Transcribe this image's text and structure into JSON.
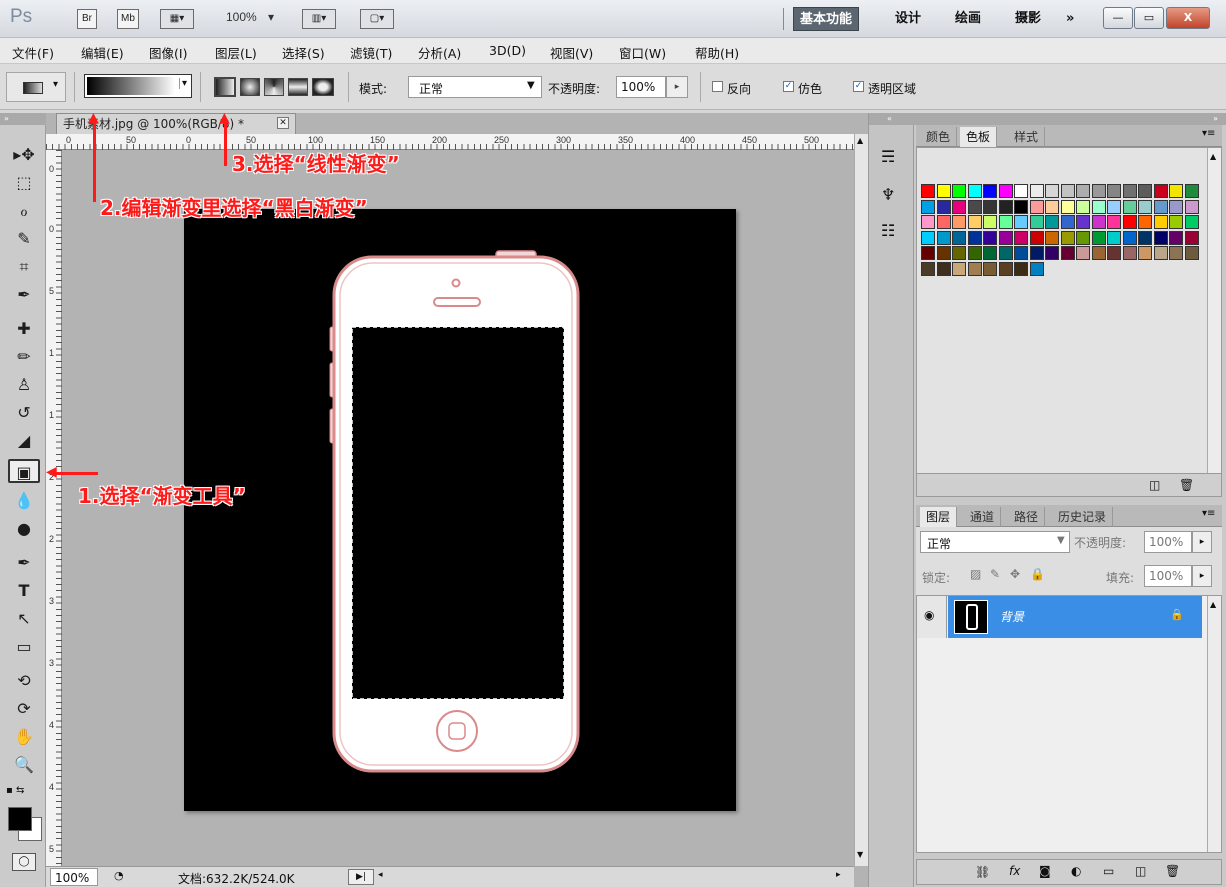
{
  "titlebar": {
    "logo": "Ps",
    "bridge": "Br",
    "minibridge": "Mb",
    "zoom": "100%",
    "workspaces": [
      "基本功能",
      "设计",
      "绘画",
      "摄影"
    ],
    "more": "»",
    "min": "—",
    "restore": "▭",
    "close": "X"
  },
  "menu": [
    "文件(F)",
    "编辑(E)",
    "图像(I)",
    "图层(L)",
    "选择(S)",
    "滤镜(T)",
    "分析(A)",
    "3D(D)",
    "视图(V)",
    "窗口(W)",
    "帮助(H)"
  ],
  "options": {
    "mode_label": "模式:",
    "mode_value": "正常",
    "opacity_label": "不透明度:",
    "opacity_value": "100%",
    "reverse": "反向",
    "dither": "仿色",
    "transparency": "透明区域"
  },
  "document": {
    "tab_title": "手机素材.jpg @ 100%(RGB/8) *",
    "ruler_h": [
      "0",
      "50",
      "0",
      "50",
      "100",
      "150",
      "200",
      "250",
      "300",
      "350",
      "400",
      "450",
      "500"
    ],
    "ruler_v": [
      "0",
      "0",
      "5",
      "1",
      "1",
      "2",
      "2",
      "3",
      "3",
      "4",
      "4",
      "5"
    ],
    "zoom": "100%",
    "doc_info": "文档:632.2K/524.0K"
  },
  "annotations": {
    "step1": "1.选择“渐变工具”",
    "step2": "2.编辑渐变里选择“黑白渐变”",
    "step3": "3.选择“线性渐变”"
  },
  "swatch_panel": {
    "tabs": [
      "颜色",
      "色板",
      "样式"
    ],
    "colors": [
      "#ff0000",
      "#ffff00",
      "#00ff00",
      "#00ffff",
      "#0000ff",
      "#ff00ff",
      "#ffffff",
      "#ebebeb",
      "#d6d6d6",
      "#c2c2c2",
      "#adadad",
      "#999999",
      "#858585",
      "#707070",
      "#5c5c5c",
      "#c8001e",
      "#f2e600",
      "#1e8c3c",
      "#00a0e6",
      "#2828a0",
      "#e6007e",
      "#4a4a4a",
      "#363636",
      "#222222",
      "#000000",
      "#ff9a9a",
      "#ffcc99",
      "#ffff99",
      "#ccff99",
      "#99ffcc",
      "#99ccff",
      "#66cc99",
      "#99cccc",
      "#6699cc",
      "#9999cc",
      "#cc99cc",
      "#ff99cc",
      "#ff6666",
      "#ff9966",
      "#ffcc66",
      "#ccff66",
      "#66ff99",
      "#66ccff",
      "#33cc99",
      "#009999",
      "#3366cc",
      "#6633cc",
      "#cc33cc",
      "#ff3399",
      "#ff0000",
      "#ff6600",
      "#ffcc00",
      "#99cc00",
      "#00cc66",
      "#00ccff",
      "#0099cc",
      "#006699",
      "#003399",
      "#330099",
      "#990099",
      "#cc0066",
      "#cc0000",
      "#cc6600",
      "#999900",
      "#669900",
      "#009933",
      "#00cccc",
      "#0066cc",
      "#003366",
      "#000066",
      "#660066",
      "#990033",
      "#660000",
      "#663300",
      "#666600",
      "#336600",
      "#006633",
      "#006666",
      "#004c99",
      "#001a66",
      "#330066",
      "#660033",
      "#cc9999",
      "#996633",
      "#663333",
      "#996666",
      "#cc9966",
      "#b8a58a",
      "#8c7355",
      "#6e5a3c",
      "#4a3a28",
      "#3f2d1e",
      "#c8a878",
      "#a07e50",
      "#7a5c34",
      "#5a4020",
      "#3c2c14",
      "#0080c0"
    ],
    "footer_icons": [
      "new-swatch-icon",
      "delete-icon"
    ]
  },
  "layers_panel": {
    "tabs": [
      "图层",
      "通道",
      "路径",
      "历史记录"
    ],
    "blend": "正常",
    "opacity_label": "不透明度:",
    "opacity_value": "100%",
    "lock_label": "锁定:",
    "fill_label": "填充:",
    "fill_value": "100%",
    "layer_name": "背景",
    "layer_color": "#3b8ee6"
  }
}
